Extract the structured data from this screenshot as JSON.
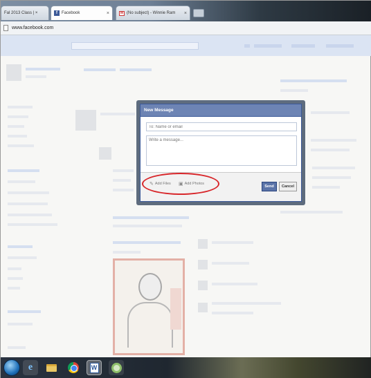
{
  "browser": {
    "tabs": [
      {
        "label": "Fal 2013 Class | ×",
        "icon": "page-icon",
        "active": false
      },
      {
        "label": "Facebook",
        "icon": "facebook-favicon",
        "active": true
      },
      {
        "label": "(No subject) - Winnie Ram",
        "icon": "gmail-favicon",
        "active": false
      }
    ],
    "tab_close": "×",
    "url": "www.facebook.com"
  },
  "modal": {
    "title": "New Message",
    "to_placeholder": "To: Name or email",
    "message_placeholder": "Write a message...",
    "attach_file_label": "Add Files",
    "attach_photo_label": "Add Photos",
    "send_label": "Send",
    "cancel_label": "Cancel",
    "highlight_color": "#d8262a"
  },
  "taskbar": {
    "ie_glyph": "e",
    "word_glyph": "W",
    "apps": [
      "start-orb",
      "internet-explorer-icon",
      "file-explorer-icon",
      "chrome-icon",
      "word-icon",
      "app-icon"
    ]
  },
  "colors": {
    "facebook_blue": "#3b5998",
    "modal_header": "#6d84b4"
  }
}
